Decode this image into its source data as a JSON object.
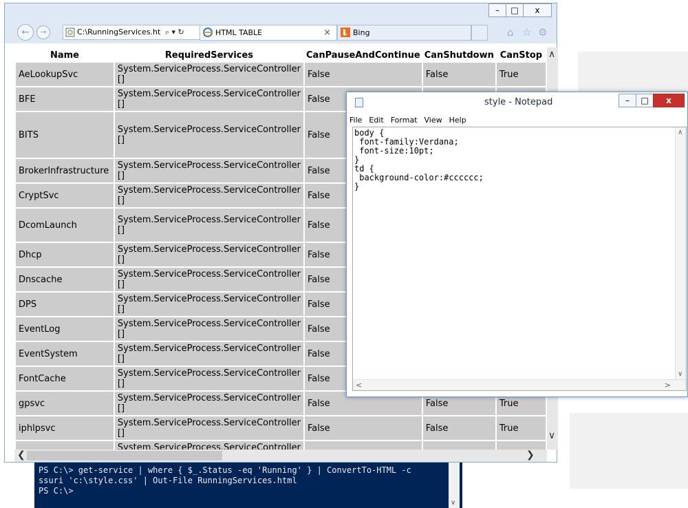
{
  "browser": {
    "address": "C:\\RunningServices.ht",
    "address_controls": "⌕ ▾ ↻",
    "tabs": [
      {
        "label": "HTML TABLE",
        "close": "×"
      },
      {
        "label": "Bing"
      }
    ],
    "window_buttons": {
      "minimize": "–",
      "maximize": "□",
      "close": "x"
    },
    "toolbar_icons": {
      "home": "⌂",
      "favorites": "☆",
      "tools": "⚙"
    }
  },
  "table": {
    "headers": [
      "Name",
      "RequiredServices",
      "CanPauseAndContinue",
      "CanShutdown",
      "CanStop"
    ],
    "required_value": "System.ServiceProcess.ServiceController\n[]",
    "rows": [
      {
        "name": "AeLookupSvc",
        "pause": "False",
        "shutdown": "False",
        "stop": "True",
        "h": 34
      },
      {
        "name": "BFE",
        "pause": "False",
        "shutdown": "",
        "stop": "",
        "h": 34
      },
      {
        "name": "BITS",
        "pause": "False",
        "shutdown": "",
        "stop": "",
        "h": 66
      },
      {
        "name": "BrokerInfrastructure",
        "pause": "False",
        "shutdown": "",
        "stop": "",
        "h": 34
      },
      {
        "name": "CryptSvc",
        "pause": "False",
        "shutdown": "",
        "stop": "",
        "h": 34
      },
      {
        "name": "DcomLaunch",
        "pause": "False",
        "shutdown": "",
        "stop": "",
        "h": 48
      },
      {
        "name": "Dhcp",
        "pause": "False",
        "shutdown": "",
        "stop": "",
        "h": 34
      },
      {
        "name": "Dnscache",
        "pause": "False",
        "shutdown": "",
        "stop": "",
        "h": 34
      },
      {
        "name": "DPS",
        "pause": "False",
        "shutdown": "",
        "stop": "",
        "h": 34
      },
      {
        "name": "EventLog",
        "pause": "False",
        "shutdown": "",
        "stop": "",
        "h": 34
      },
      {
        "name": "EventSystem",
        "pause": "False",
        "shutdown": "",
        "stop": "",
        "h": 34
      },
      {
        "name": "FontCache",
        "pause": "False",
        "shutdown": "",
        "stop": "",
        "h": 34
      },
      {
        "name": "gpsvc",
        "pause": "False",
        "shutdown": "False",
        "stop": "True",
        "h": 34
      },
      {
        "name": "iphlpsvc",
        "pause": "False",
        "shutdown": "False",
        "stop": "True",
        "h": 34
      },
      {
        "name": "",
        "pause": "",
        "shutdown": "",
        "stop": "",
        "h": 34
      }
    ]
  },
  "notepad": {
    "title": "style - Notepad",
    "menu": [
      "File",
      "Edit",
      "Format",
      "View",
      "Help"
    ],
    "content": "body {\n font-family:Verdana;\n font-size:10pt;\n}\ntd {\n background-color:#cccccc;\n}",
    "window_buttons": {
      "minimize": "–",
      "maximize": "□",
      "close": "x"
    }
  },
  "powershell": {
    "text": "PS C:\\> get-service | where { $_.Status -eq 'Running' } | ConvertTo-HTML -c\nssuri 'c:\\style.css' | Out-File RunningServices.html\nPS C:\\>"
  },
  "scroll_arrows": {
    "up": "∧",
    "down": "∨",
    "left": "❮",
    "right": "❯",
    "small_left": "<",
    "small_right": ">"
  },
  "colors": {
    "cell_bg": "#cccccc",
    "ps_bg": "#012456",
    "notepad_close": "#c7312b",
    "ie_close": "#c7312b",
    "bing": "#f26a1b"
  }
}
